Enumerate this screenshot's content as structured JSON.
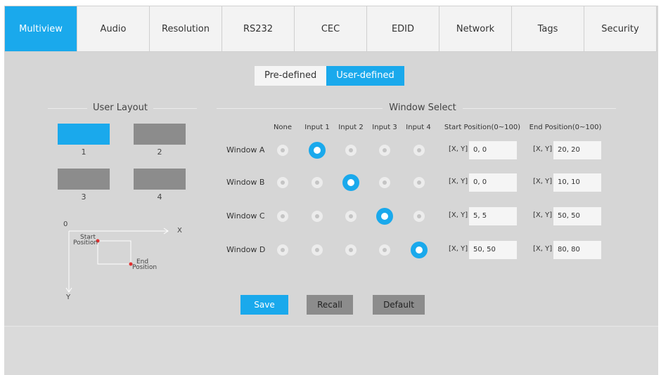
{
  "tabs": [
    "Multiview",
    "Audio",
    "Resolution",
    "RS232",
    "CEC",
    "EDID",
    "Network",
    "Tags",
    "Security"
  ],
  "mode": {
    "predefined": "Pre-defined",
    "userdefined": "User-defined",
    "selected": "User-defined"
  },
  "user_layout": {
    "title": "User Layout",
    "tiles": [
      {
        "label": "1",
        "selected": true
      },
      {
        "label": "2",
        "selected": false
      },
      {
        "label": "3",
        "selected": false
      },
      {
        "label": "4",
        "selected": false
      }
    ],
    "diagram": {
      "origin": "0",
      "x_axis": "X",
      "y_axis": "Y",
      "start_line1": "Start",
      "start_line2": "Position",
      "end_line1": "End",
      "end_line2": "Position"
    }
  },
  "window_select": {
    "title": "Window Select",
    "columns": [
      "None",
      "Input 1",
      "Input 2",
      "Input 3",
      "Input 4",
      "Start Position(0~100)",
      "End Position(0~100)"
    ],
    "xy_label": "[X, Y]",
    "rows": [
      {
        "name": "Window A",
        "selected_input": 1,
        "start": "0, 0",
        "end": "20, 20"
      },
      {
        "name": "Window B",
        "selected_input": 2,
        "start": "0, 0",
        "end": "10, 10"
      },
      {
        "name": "Window C",
        "selected_input": 3,
        "start": "5, 5",
        "end": "50, 50"
      },
      {
        "name": "Window D",
        "selected_input": 4,
        "start": "50, 50",
        "end": "80, 80"
      }
    ]
  },
  "buttons": {
    "save": "Save",
    "recall": "Recall",
    "default": "Default"
  },
  "colors": {
    "accent": "#1aa9ec",
    "panel": "#d6d6d6",
    "tile_off": "#8c8c8c"
  }
}
